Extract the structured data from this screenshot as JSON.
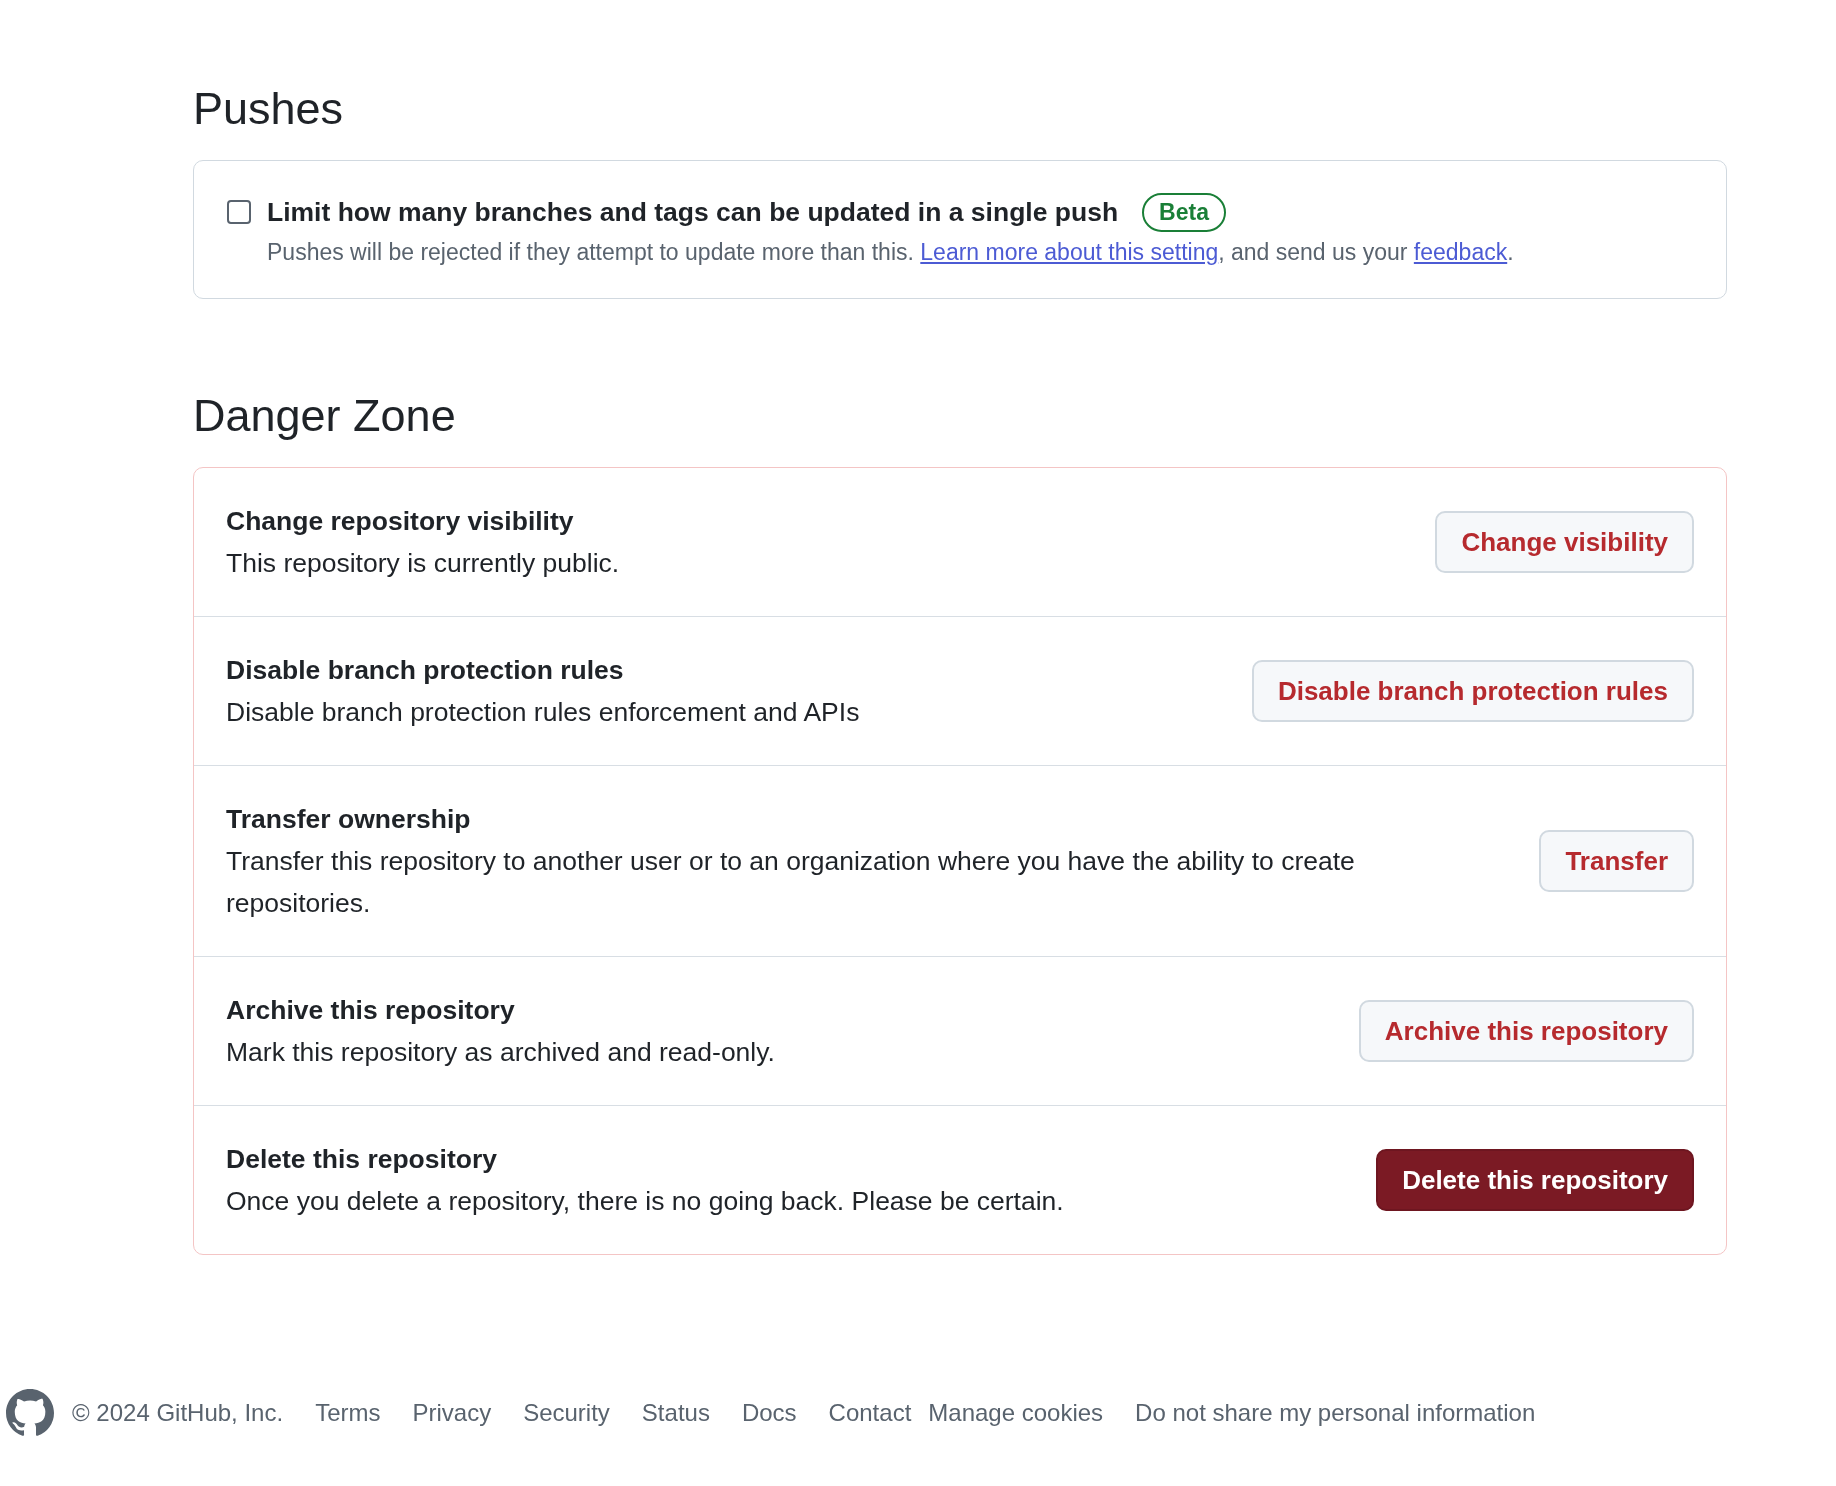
{
  "pushes": {
    "heading": "Pushes",
    "setting": {
      "label": "Limit how many branches and tags can be updated in a single push",
      "checked": false,
      "badge": "Beta",
      "description": [
        {
          "kind": "text",
          "text": "Pushes will be rejected if they attempt to update more than this. "
        },
        {
          "kind": "link",
          "text": "Learn more about this setting"
        },
        {
          "kind": "text",
          "text": ", and send us your "
        },
        {
          "kind": "link",
          "text": "feedback"
        },
        {
          "kind": "text",
          "text": "."
        }
      ]
    }
  },
  "danger_zone": {
    "heading": "Danger Zone",
    "items": [
      {
        "title": "Change repository visibility",
        "description": "This repository is currently public.",
        "action": {
          "label": "Change visibility",
          "kind": "outline"
        }
      },
      {
        "title": "Disable branch protection rules",
        "description": "Disable branch protection rules enforcement and APIs",
        "action": {
          "label": "Disable branch protection rules",
          "kind": "outline"
        }
      },
      {
        "title": "Transfer ownership",
        "description": "Transfer this repository to another user or to an organization where you have the ability to create repositories.",
        "action": {
          "label": "Transfer",
          "kind": "outline"
        }
      },
      {
        "title": "Archive this repository",
        "description": "Mark this repository as archived and read-only.",
        "action": {
          "label": "Archive this repository",
          "kind": "outline"
        }
      },
      {
        "title": "Delete this repository",
        "description": "Once you delete a repository, there is no going back. Please be certain.",
        "action": {
          "label": "Delete this repository",
          "kind": "filled"
        }
      }
    ]
  },
  "footer": {
    "copyright": "© 2024 GitHub, Inc.",
    "links": [
      {
        "label": "Terms",
        "kind": "link"
      },
      {
        "label": "Privacy",
        "kind": "link"
      },
      {
        "label": "Security",
        "kind": "link"
      },
      {
        "label": "Status",
        "kind": "link"
      },
      {
        "label": "Docs",
        "kind": "link"
      },
      {
        "label": "Contact",
        "kind": "link"
      },
      {
        "label": "Manage cookies",
        "kind": "button"
      },
      {
        "label": "Do not share my personal information",
        "kind": "link"
      }
    ]
  }
}
